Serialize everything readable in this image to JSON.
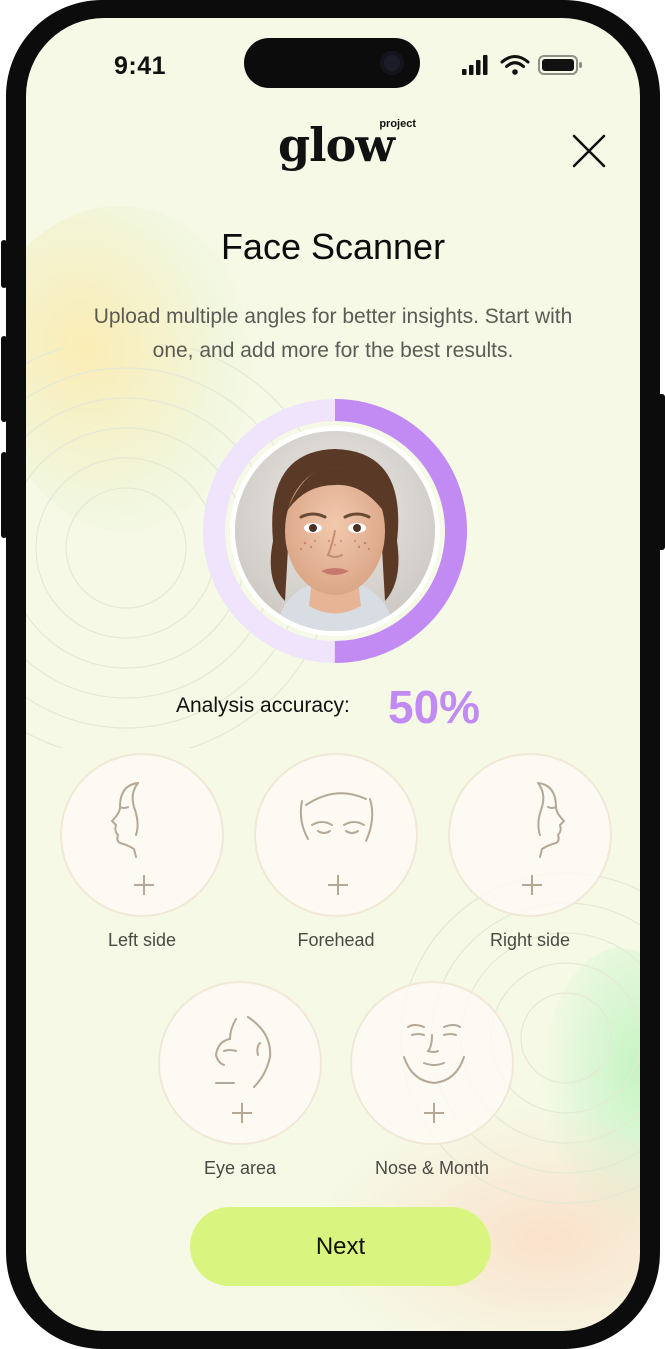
{
  "status_bar": {
    "time": "9:41"
  },
  "header": {
    "logo_small": "project",
    "logo_main": "glow"
  },
  "title": "Face Scanner",
  "subtitle": "Upload multiple angles for better insights. Start with one, and add more for the best results.",
  "scan": {
    "progress": 0.5,
    "accent_color": "#c28bf4",
    "track_color": "#efe4fb"
  },
  "accuracy": {
    "label": "Analysis accuracy:",
    "value": "50%"
  },
  "angles": [
    {
      "label": "Left side",
      "icon": "face-left-profile-icon"
    },
    {
      "label": "Forehead",
      "icon": "forehead-icon"
    },
    {
      "label": "Right side",
      "icon": "face-right-profile-icon"
    },
    {
      "label": "Eye area",
      "icon": "eye-area-icon"
    },
    {
      "label": "Nose & Month",
      "icon": "nose-mouth-icon"
    }
  ],
  "next_label": "Next",
  "colors": {
    "background": "#f5f9e6",
    "button": "#daf57f",
    "icon_line": "#b5a896"
  }
}
